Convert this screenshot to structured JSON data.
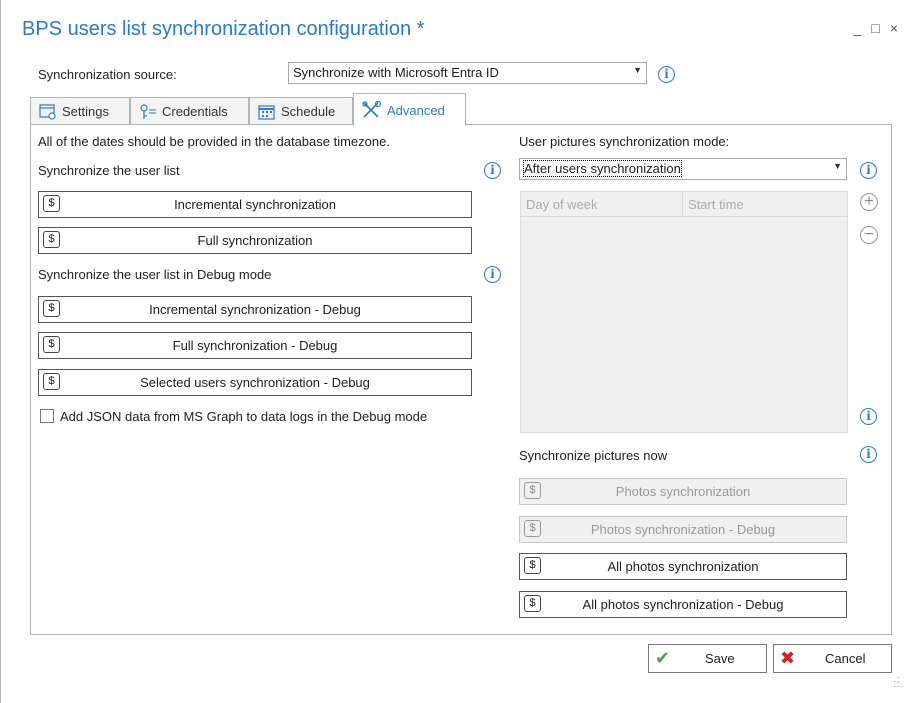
{
  "window": {
    "title": "BPS users list synchronization configuration *",
    "minimize": "_",
    "maximize": "□",
    "close": "×"
  },
  "source": {
    "label": "Synchronization source:",
    "value": "Synchronize with Microsoft Entra ID"
  },
  "tabs": [
    {
      "label": "Settings",
      "icon": "settings-icon"
    },
    {
      "label": "Credentials",
      "icon": "key-icon"
    },
    {
      "label": "Schedule",
      "icon": "calendar-icon"
    },
    {
      "label": "Advanced",
      "icon": "tools-icon",
      "active": true
    }
  ],
  "left": {
    "timezone_note": "All of the dates should be provided in the database timezone.",
    "sync_list_label": "Synchronize the user list",
    "buttons": [
      "Incremental synchronization",
      "Full synchronization"
    ],
    "debug_label": "Synchronize the user list in Debug mode",
    "debug_buttons": [
      "Incremental synchronization - Debug",
      "Full synchronization - Debug",
      "Selected users synchronization - Debug"
    ],
    "checkbox_label": "Add JSON data from MS Graph to data logs in the Debug mode"
  },
  "right": {
    "pictures_mode_label": "User pictures synchronization mode:",
    "pictures_mode_value": "After users synchronization",
    "grid_columns": [
      "Day of week",
      "Start time"
    ],
    "add_symbol": "+",
    "remove_symbol": "−",
    "sync_now_label": "Synchronize pictures now",
    "photo_buttons": [
      {
        "label": "Photos synchronization",
        "enabled": false
      },
      {
        "label": "Photos synchronization - Debug",
        "enabled": false
      },
      {
        "label": "All photos synchronization",
        "enabled": true
      },
      {
        "label": "All photos synchronization - Debug",
        "enabled": true
      }
    ]
  },
  "footer": {
    "save": "Save",
    "cancel": "Cancel"
  },
  "colors": {
    "accent": "#2b7bc9",
    "save_icon": "#4aa64a",
    "cancel_icon": "#d22222"
  }
}
